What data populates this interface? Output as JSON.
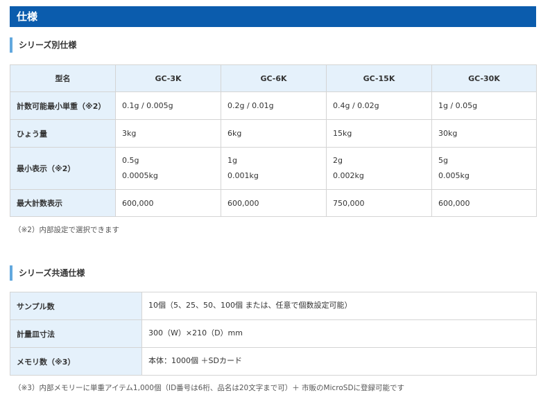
{
  "page_title": "仕様",
  "series_section": {
    "heading": "シリーズ別仕様",
    "header": [
      "型名",
      "GC-3K",
      "GC-6K",
      "GC-15K",
      "GC-30K"
    ],
    "rows": [
      {
        "label": "計数可能最小単重（※2）",
        "cells": [
          [
            "0.1g / 0.005g"
          ],
          [
            "0.2g / 0.01g"
          ],
          [
            "0.4g / 0.02g"
          ],
          [
            "1g / 0.05g"
          ]
        ]
      },
      {
        "label": "ひょう量",
        "cells": [
          [
            "3kg"
          ],
          [
            "6kg"
          ],
          [
            "15kg"
          ],
          [
            "30kg"
          ]
        ]
      },
      {
        "label": "最小表示（※2）",
        "cells": [
          [
            "0.5g",
            "0.0005kg"
          ],
          [
            "1g",
            "0.001kg"
          ],
          [
            "2g",
            "0.002kg"
          ],
          [
            "5g",
            "0.005kg"
          ]
        ]
      },
      {
        "label": "最大計数表示",
        "cells": [
          [
            "600,000"
          ],
          [
            "600,000"
          ],
          [
            "750,000"
          ],
          [
            "600,000"
          ]
        ]
      }
    ],
    "note": "（※2）内部設定で選択できます"
  },
  "common_section": {
    "heading": "シリーズ共通仕様",
    "rows": [
      {
        "label": "サンプル数",
        "value": "10個（5、25、50、100個 または、任意で個数設定可能）"
      },
      {
        "label": "計量皿寸法",
        "value": "300（W）×210（D）mm"
      },
      {
        "label": "メモリ数（※3）",
        "value": "本体：1000個 ＋SDカード"
      }
    ],
    "note": "（※3）内部メモリーに単重アイテム1,000個（ID番号は6桁、品名は20文字まで可）＋ 市販のMicroSDに登録可能です"
  }
}
